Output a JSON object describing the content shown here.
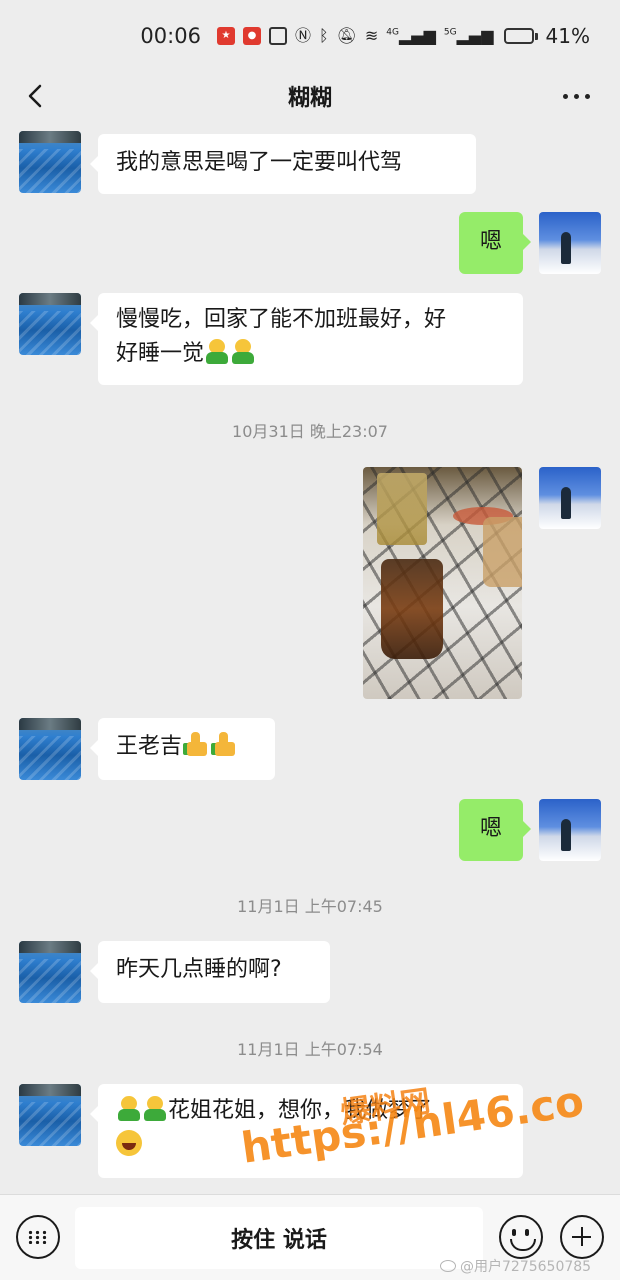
{
  "status_bar": {
    "time": "00:06",
    "battery_percent": "41%",
    "battery_level": 0.41,
    "network_1": "4G",
    "network_2": "5G"
  },
  "nav": {
    "title": "糊糊"
  },
  "messages": [
    {
      "side": "left",
      "text": "我的意思是喝了一定要叫代驾"
    },
    {
      "side": "right",
      "text": "嗯"
    },
    {
      "side": "left",
      "text_line1": "慢慢吃，回家了能不加班最好，好",
      "text_line2": "好睡一觉"
    },
    {
      "timestamp": "10月31日 晚上23:07"
    },
    {
      "side": "right",
      "type": "image"
    },
    {
      "side": "left",
      "text": "王老吉"
    },
    {
      "side": "right",
      "text": "嗯"
    },
    {
      "timestamp": "11月1日 上午07:45"
    },
    {
      "side": "left",
      "text": "昨天几点睡的啊?"
    },
    {
      "timestamp": "11月1日 上午07:54"
    },
    {
      "side": "left",
      "text_line1": "花姐花姐，想你，我做梦了"
    }
  ],
  "watermark": {
    "line1": "爆料网",
    "line2": "https://hl46.co"
  },
  "input_bar": {
    "hold_to_talk": "按住 说话"
  },
  "credit": "@用户7275650785",
  "colors": {
    "background": "#ededed",
    "bubble_self": "#95ec69",
    "bubble_other": "#ffffff"
  }
}
